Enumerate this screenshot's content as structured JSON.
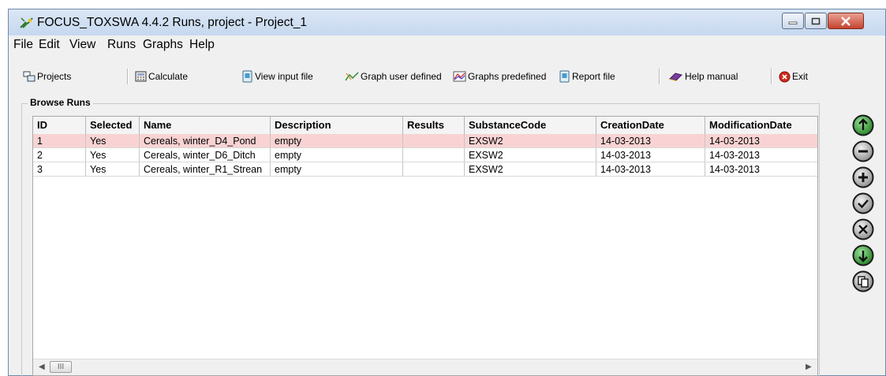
{
  "window": {
    "title": "FOCUS_TOXSWA 4.4.2 Runs, project - Project_1"
  },
  "menu": [
    "File",
    "Edit",
    "View",
    "Runs",
    "Graphs",
    "Help"
  ],
  "toolbar": {
    "projects": "Projects",
    "calculate": "Calculate",
    "view_input_file": "View input file",
    "graph_user_defined": "Graph user defined",
    "graphs_predefined": "Graphs predefined",
    "report_file": "Report file",
    "help_manual": "Help manual",
    "exit": "Exit"
  },
  "browse_runs": {
    "label": "Browse Runs",
    "columns": [
      "ID",
      "Selected",
      "Name",
      "Description",
      "Results",
      "SubstanceCode",
      "CreationDate",
      "ModificationDate"
    ],
    "rows": [
      [
        "1",
        "Yes",
        "Cereals, winter_D4_Pond",
        "empty",
        "",
        "EXSW2",
        "14-03-2013",
        "14-03-2013"
      ],
      [
        "2",
        "Yes",
        "Cereals, winter_D6_Ditch",
        "empty",
        "",
        "EXSW2",
        "14-03-2013",
        "14-03-2013"
      ],
      [
        "3",
        "Yes",
        "Cereals, winter_R1_Strean",
        "empty",
        "",
        "EXSW2",
        "14-03-2013",
        "14-03-2013"
      ]
    ],
    "selected_row": 0
  },
  "scrollbar": {
    "thumb_glyph": "III"
  },
  "side_buttons": [
    "move-up",
    "remove",
    "add",
    "check",
    "cancel",
    "move-down",
    "copy"
  ],
  "colors": {
    "selected_row": "#f9d3d3",
    "green_button": "#2e9d2e",
    "gray_button": "#8a8a8a",
    "close_button": "#c64330"
  }
}
